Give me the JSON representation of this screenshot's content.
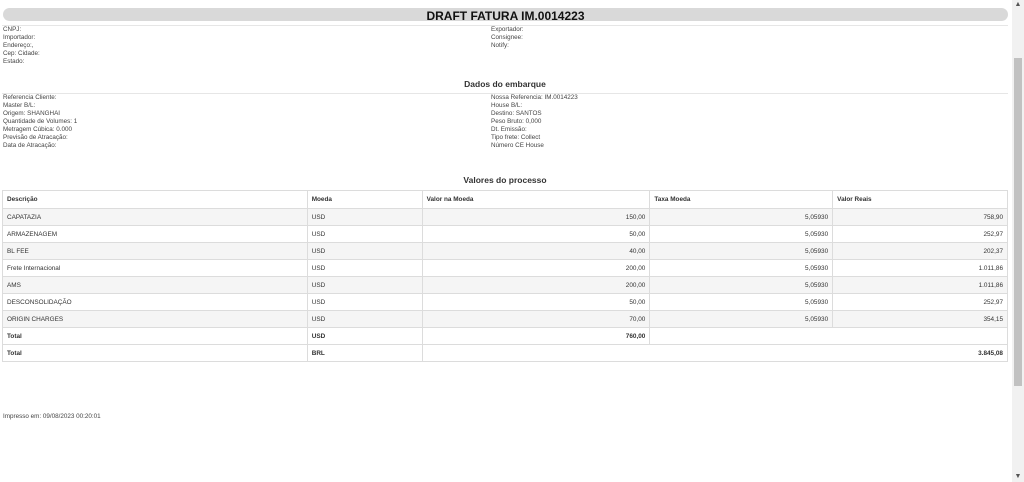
{
  "header": {
    "title": "DRAFT FATURA IM.0014223"
  },
  "party_left": [
    "CNPJ:",
    "Importador:",
    "Endereço:,",
    "Cep: Cidade:",
    "Estado:"
  ],
  "party_right": [
    "Exportador:",
    "Consignee:",
    "Notify:"
  ],
  "shipment": {
    "title": "Dados do embarque",
    "left": [
      "Referencia Cliente:",
      "Master B/L:",
      "Origem: SHANGHAI",
      "Quantidade de Volumes: 1",
      "Metragem Cúbica: 0.000",
      "Previsão de Atracação:",
      "Data de Atracação:"
    ],
    "right": [
      "Nossa Referencia: IM.0014223",
      "House B/L:",
      "Destino: SANTOS",
      "Peso Bruto: 0,000",
      "Dt. Emissão:",
      "Tipo frete: Collect",
      "Número CE House"
    ]
  },
  "values": {
    "title": "Valores do processo",
    "headers": [
      "Descrição",
      "Moeda",
      "Valor na Moeda",
      "Taxa Moeda",
      "Valor Reais"
    ],
    "rows": [
      [
        "CAPATAZIA",
        "USD",
        "150,00",
        "5,05930",
        "758,90"
      ],
      [
        "ARMAZENAGEM",
        "USD",
        "50,00",
        "5,05930",
        "252,97"
      ],
      [
        "BL FEE",
        "USD",
        "40,00",
        "5,05930",
        "202,37"
      ],
      [
        "Frete Internacional",
        "USD",
        "200,00",
        "5,05930",
        "1.011,86"
      ],
      [
        "AMS",
        "USD",
        "200,00",
        "5,05930",
        "1.011,86"
      ],
      [
        "DESCONSOLIDAÇÃO",
        "USD",
        "50,00",
        "5,05930",
        "252,97"
      ],
      [
        "ORIGIN CHARGES",
        "USD",
        "70,00",
        "5,05930",
        "354,15"
      ]
    ],
    "total_usd": {
      "label": "Total",
      "currency": "USD",
      "value": "760,00"
    },
    "total_brl": {
      "label": "Total",
      "currency": "BRL",
      "value": "3.845,08"
    }
  },
  "footer": {
    "printed": "Impresso em: 09/08/2023 00:20:01"
  },
  "scrollbar": {
    "up": "▲",
    "down": "▼"
  }
}
